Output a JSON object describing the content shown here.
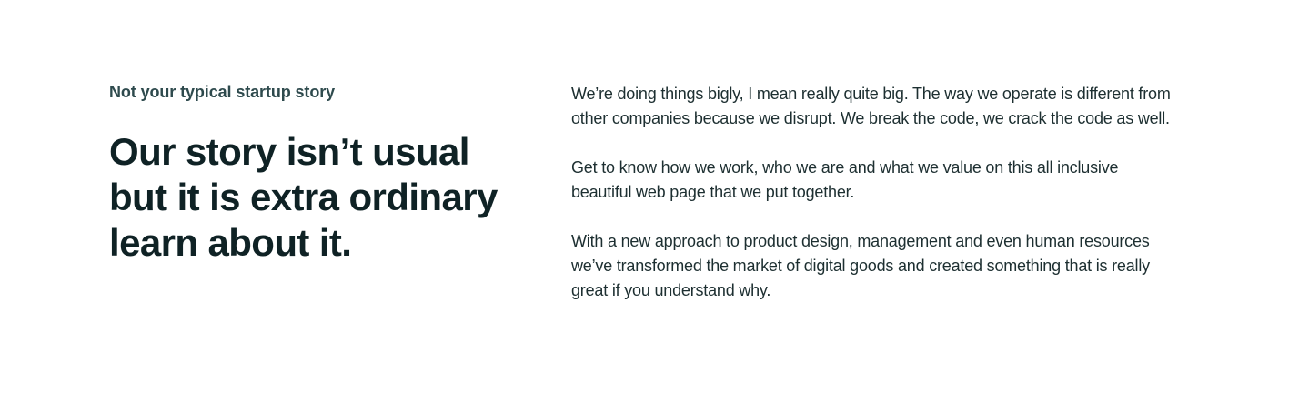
{
  "story": {
    "eyebrow": "Not your typical startup story",
    "headline_lines": [
      "Our story isn’t usual",
      "but it is extra ordinary",
      "learn about it."
    ],
    "paragraphs": [
      "We’re doing things bigly, I mean really quite big. The way we operate is different from other companies because we disrupt. We break the code, we crack the code as well.",
      "Get to know how we work, who we are and what we value on this all inclusive beautiful web page that we put together.",
      "With a new approach to product design, management and even human resources we’ve transformed the market  of digital goods and created something that is really great if you understand why."
    ]
  }
}
